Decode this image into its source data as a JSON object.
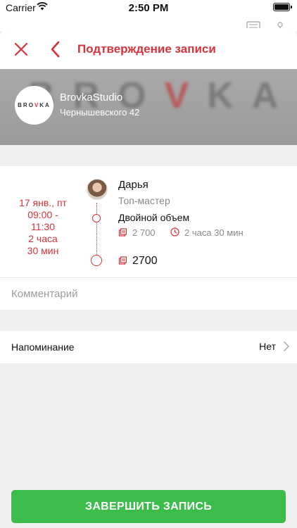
{
  "status_bar": {
    "carrier": "Carrier",
    "time": "2:50 PM"
  },
  "header": {
    "title": "Подтверждение записи"
  },
  "studio": {
    "name": "BrovkaStudio",
    "address": "Чернышевского 42",
    "logo_text_pre": "BRO",
    "logo_text_v": "V",
    "logo_text_post": "KA"
  },
  "appointment": {
    "date": "17 янв., пт",
    "time_range_line1": "09:00 -",
    "time_range_line2": "11:30",
    "duration_line1": "2 часа",
    "duration_line2": "30 мин",
    "master_name": "Дарья",
    "master_role": "Топ-мастер",
    "service_name": "Двойной объем",
    "service_price": "2 700",
    "service_duration": "2 часа 30 мин",
    "total": "2700"
  },
  "comment": {
    "placeholder": "Комментарий",
    "value": ""
  },
  "reminder": {
    "label": "Напоминание",
    "value": "Нет"
  },
  "actions": {
    "finish_label": "ЗАВЕРШИТЬ ЗАПИСЬ"
  },
  "colors": {
    "accent": "#d8333a",
    "button": "#3cbc4a",
    "muted": "#8a8a8a"
  },
  "icons": [
    "wifi-icon",
    "battery-icon",
    "close-icon",
    "back-icon",
    "price-tag-icon",
    "clock-icon",
    "chevron-right-icon"
  ]
}
